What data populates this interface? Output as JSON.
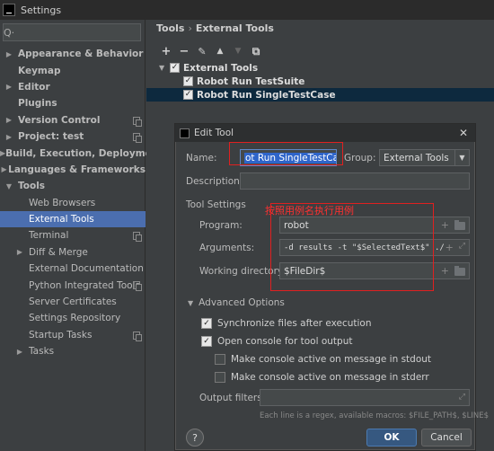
{
  "window": {
    "title": "Settings"
  },
  "search": {
    "placeholder": "",
    "value": ""
  },
  "sidebar": {
    "items": [
      {
        "label": "Appearance & Behavior",
        "arrow": "▶",
        "bold": true
      },
      {
        "label": "Keymap",
        "arrow": "",
        "bold": true
      },
      {
        "label": "Editor",
        "arrow": "▶",
        "bold": true
      },
      {
        "label": "Plugins",
        "arrow": "",
        "bold": true
      },
      {
        "label": "Version Control",
        "arrow": "▶",
        "bold": true
      },
      {
        "label": "Project: test",
        "arrow": "▶",
        "bold": true
      },
      {
        "label": "Build, Execution, Deployment",
        "arrow": "▶",
        "bold": true
      },
      {
        "label": "Languages & Frameworks",
        "arrow": "▶",
        "bold": true
      },
      {
        "label": "Tools",
        "arrow": "▼",
        "bold": true
      },
      {
        "label": "Web Browsers",
        "arrow": "",
        "bold": false
      },
      {
        "label": "External Tools",
        "arrow": "",
        "bold": false
      },
      {
        "label": "Terminal",
        "arrow": "",
        "bold": false
      },
      {
        "label": "Diff & Merge",
        "arrow": "▶",
        "bold": false
      },
      {
        "label": "External Documentation",
        "arrow": "",
        "bold": false
      },
      {
        "label": "Python Integrated Tools",
        "arrow": "",
        "bold": false
      },
      {
        "label": "Server Certificates",
        "arrow": "",
        "bold": false
      },
      {
        "label": "Settings Repository",
        "arrow": "",
        "bold": false
      },
      {
        "label": "Startup Tasks",
        "arrow": "",
        "bold": false
      },
      {
        "label": "Tasks",
        "arrow": "▶",
        "bold": false
      }
    ]
  },
  "breadcrumb": {
    "root": "Tools",
    "separator": "›",
    "current": "External Tools"
  },
  "toolbar": {
    "add": "+",
    "remove": "−",
    "edit": "✎",
    "up": "▲",
    "down": "▼",
    "copy": "⧉"
  },
  "tools_tree": {
    "group": "External Tools",
    "items": [
      "Robot Run TestSuite",
      "Robot Run SingleTestCase"
    ]
  },
  "dialog": {
    "title": "Edit Tool",
    "close": "✕",
    "name_label": "Name:",
    "name_value": "ot Run SingleTestCase",
    "group_label": "Group:",
    "group_value": "External Tools",
    "description_label": "Description:",
    "description_value": "",
    "annotation": "按照用例名执行用例",
    "tool_settings": "Tool Settings",
    "program_label": "Program:",
    "program_value": "robot",
    "arguments_label": "Arguments:",
    "arguments_value": "-d results -t \"$SelectedText$\"  ./",
    "working_dir_label": "Working directory:",
    "working_dir_value": "$FileDir$",
    "advanced": "Advanced Options",
    "sync_label": "Synchronize files after execution",
    "console_label": "Open console for tool output",
    "stdout_label": "Make console active on message in stdout",
    "stderr_label": "Make console active on message in stderr",
    "output_filters_label": "Output filters:",
    "hint": "Each line is a regex, available macros: $FILE_PATH$, $LINE$",
    "help": "?",
    "ok": "OK",
    "cancel": "Cancel"
  }
}
